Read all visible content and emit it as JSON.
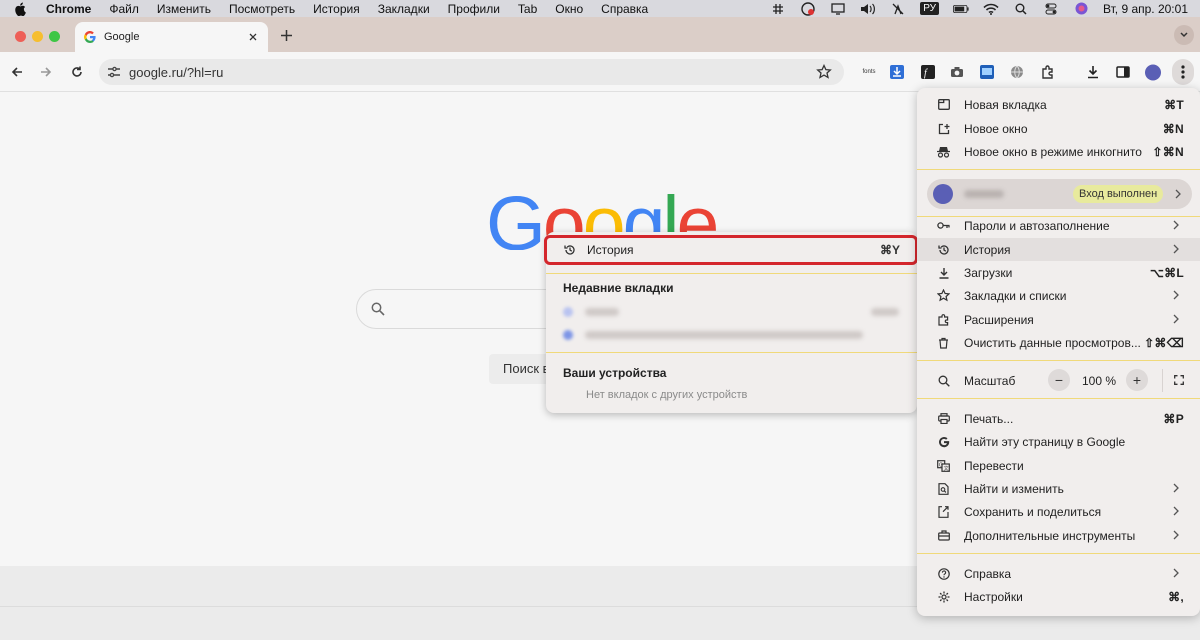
{
  "menubar": {
    "app": "Chrome",
    "items": [
      "Файл",
      "Изменить",
      "Посмотреть",
      "История",
      "Закладки",
      "Профили",
      "Tab",
      "Окно",
      "Справка"
    ],
    "keyboard_layout": "РУ",
    "clock": "Вт, 9 апр.  20:01"
  },
  "tab": {
    "title": "Google",
    "favicon": "google-g-icon"
  },
  "omnibox": {
    "url": "google.ru/?hl=ru"
  },
  "toolbar": {
    "fonts_label": "fonts",
    "profile_color": "#5a5fb5"
  },
  "page": {
    "logo_letters": [
      "G",
      "o",
      "o",
      "g",
      "l",
      "e"
    ],
    "logo_colors": [
      "#4285f4",
      "#ea4335",
      "#fbbc05",
      "#4285f4",
      "#34a853",
      "#ea4335"
    ],
    "search_button": "Поиск в Google"
  },
  "history_submenu": {
    "history_item": {
      "label": "История",
      "shortcut": "⌘Y",
      "icon": "history-icon"
    },
    "recent_tabs_heading": "Недавние вкладки",
    "devices_heading": "Ваши устройства",
    "no_devices_text": "Нет вкладок с других устройств",
    "highlight_color": "#d4262c"
  },
  "menu": {
    "group1": [
      {
        "label": "Новая вкладка",
        "shortcut": "⌘T",
        "icon": "new-tab-icon"
      },
      {
        "label": "Новое окно",
        "shortcut": "⌘N",
        "icon": "new-window-icon"
      },
      {
        "label": "Новое окно в режиме инкогнито",
        "shortcut": "⇧⌘N",
        "icon": "incognito-icon"
      }
    ],
    "profile": {
      "badge": "Вход выполнен"
    },
    "group2": [
      {
        "label": "Пароли и автозаполнение",
        "icon": "key-icon",
        "submenu": true
      },
      {
        "label": "История",
        "icon": "history-icon",
        "submenu": true,
        "highlighted": true
      },
      {
        "label": "Загрузки",
        "shortcut": "⌥⌘L",
        "icon": "download-icon"
      },
      {
        "label": "Закладки и списки",
        "icon": "star-icon",
        "submenu": true
      },
      {
        "label": "Расширения",
        "icon": "puzzle-icon",
        "submenu": true
      },
      {
        "label": "Очистить данные просмотров...",
        "shortcut": "⇧⌘⌫",
        "icon": "trash-icon"
      }
    ],
    "zoom": {
      "label": "Масштаб",
      "minus": "−",
      "value": "100 %",
      "plus": "+"
    },
    "group3": [
      {
        "label": "Печать...",
        "shortcut": "⌘P",
        "icon": "print-icon"
      },
      {
        "label": "Найти эту страницу в Google",
        "icon": "google-g-icon"
      },
      {
        "label": "Перевести",
        "icon": "translate-icon"
      },
      {
        "label": "Найти и изменить",
        "icon": "find-icon",
        "submenu": true
      },
      {
        "label": "Сохранить и поделиться",
        "icon": "share-icon",
        "submenu": true
      },
      {
        "label": "Дополнительные инструменты",
        "icon": "toolbox-icon",
        "submenu": true
      }
    ],
    "group4": [
      {
        "label": "Справка",
        "icon": "help-icon",
        "submenu": true
      },
      {
        "label": "Настройки",
        "shortcut": "⌘,",
        "icon": "gear-icon"
      }
    ]
  }
}
